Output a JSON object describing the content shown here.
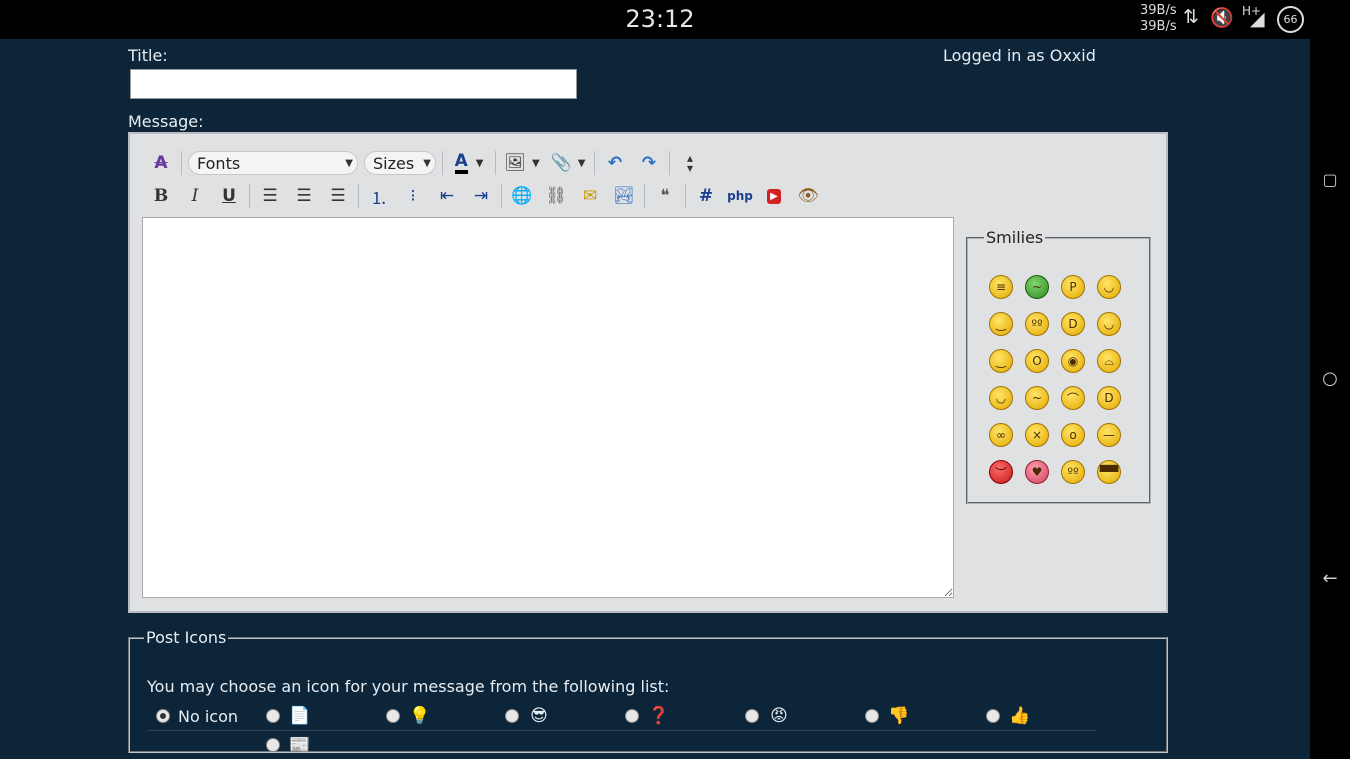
{
  "status_bar": {
    "time": "23:12",
    "net_up": "39B/s",
    "net_down": "39B/s",
    "network": "H+",
    "battery": "66"
  },
  "form": {
    "title_label": "Title:",
    "title_value": "",
    "message_label": "Message:",
    "logged_in_prefix": "Logged in as ",
    "username": "Oxxid"
  },
  "toolbar": {
    "fonts_label": "Fonts",
    "sizes_label": "Sizes",
    "font_color_label": "A",
    "bold": "B",
    "italic": "I",
    "underline": "U"
  },
  "smilies": {
    "legend": "Smilies",
    "items": [
      {
        "icon": "grimace-smiley-icon",
        "tone": "yellow",
        "glyph": "≡"
      },
      {
        "icon": "sick-smiley-icon",
        "tone": "green",
        "glyph": "~"
      },
      {
        "icon": "tongue-smiley-icon",
        "tone": "yellow",
        "glyph": "P"
      },
      {
        "icon": "idea-smiley-icon",
        "tone": "yellow",
        "glyph": "◡"
      },
      {
        "icon": "smirk-smiley-icon",
        "tone": "yellow",
        "glyph": "‿"
      },
      {
        "icon": "rolleyes-smiley-icon",
        "tone": "yellow",
        "glyph": "ºº"
      },
      {
        "icon": "laugh-smiley-icon",
        "tone": "yellow",
        "glyph": "D"
      },
      {
        "icon": "content-smiley-icon",
        "tone": "yellow",
        "glyph": "◡"
      },
      {
        "icon": "wink-smiley-icon",
        "tone": "yellow",
        "glyph": "‿"
      },
      {
        "icon": "shocked-smiley-icon",
        "tone": "yellow",
        "glyph": "O"
      },
      {
        "icon": "big-grin-eyes-smiley-icon",
        "tone": "yellow",
        "glyph": "◉"
      },
      {
        "icon": "cry-smiley-icon",
        "tone": "yellow",
        "glyph": "⌓"
      },
      {
        "icon": "smile-smiley-icon",
        "tone": "yellow",
        "glyph": "◡"
      },
      {
        "icon": "confused-smiley-icon",
        "tone": "yellow",
        "glyph": "~"
      },
      {
        "icon": "worried-smiley-icon",
        "tone": "yellow",
        "glyph": "⌒"
      },
      {
        "icon": "biggrin-smiley-icon",
        "tone": "yellow",
        "glyph": "D"
      },
      {
        "icon": "nerd-smiley-icon",
        "tone": "yellow",
        "glyph": "∞"
      },
      {
        "icon": "dead-smiley-icon",
        "tone": "yellow",
        "glyph": "×"
      },
      {
        "icon": "blush-smiley-icon",
        "tone": "yellow",
        "glyph": "o"
      },
      {
        "icon": "neutral-smiley-icon",
        "tone": "yellow",
        "glyph": "—"
      },
      {
        "icon": "mad-smiley-icon",
        "tone": "red",
        "glyph": "︶"
      },
      {
        "icon": "love-smiley-icon",
        "tone": "pink",
        "glyph": "♥"
      },
      {
        "icon": "goofy-smiley-icon",
        "tone": "yellow",
        "glyph": "ºº"
      },
      {
        "icon": "cool-smiley-icon",
        "tone": "yellow",
        "glyph": "▀▀"
      }
    ]
  },
  "post_icons": {
    "legend": "Post Icons",
    "instruction": "You may choose an icon for your message from the following list:",
    "no_icon_label": "No icon",
    "options": [
      {
        "icon": "document-icon",
        "glyph": "📄"
      },
      {
        "icon": "lightbulb-icon",
        "glyph": "💡"
      },
      {
        "icon": "cool-face-icon",
        "glyph": "😎"
      },
      {
        "icon": "question-icon",
        "glyph": "❓"
      },
      {
        "icon": "angry-face-icon",
        "glyph": "😡"
      },
      {
        "icon": "thumbs-down-icon",
        "glyph": "👎"
      },
      {
        "icon": "thumbs-up-icon",
        "glyph": "👍"
      },
      {
        "icon": "news-icon",
        "glyph": "📰"
      }
    ],
    "selected": "No icon"
  }
}
